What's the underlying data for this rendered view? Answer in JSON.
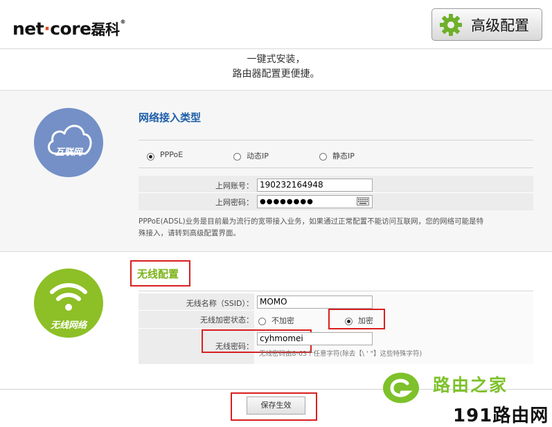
{
  "header": {
    "logo_main": "net",
    "logo_dot": "·",
    "logo_rest": "core",
    "logo_cn": "磊科",
    "logo_reg": "®",
    "advanced_button": "高级配置"
  },
  "slogan": {
    "line1": "一键式安装，",
    "line2": "路由器配置更便捷。"
  },
  "internet": {
    "icon_label": "互联网",
    "title": "网络接入类型",
    "options": [
      {
        "label": "PPPoE",
        "selected": true
      },
      {
        "label": "动态IP",
        "selected": false
      },
      {
        "label": "静态IP",
        "selected": false
      }
    ],
    "account_label": "上网账号：",
    "account_value": "190232164948",
    "password_label": "上网密码：",
    "password_value": "●●●●●●●●",
    "description_line1": "PPPoE(ADSL)业务是目前最为流行的宽带接入业务，如果通过正常配置不能访问互联网，您的网络可能是特",
    "description_line2": "殊接入，请转到高级配置界面。"
  },
  "wireless": {
    "icon_label": "无线网络",
    "title": "无线配置",
    "ssid_label": "无线名称（SSID）：",
    "ssid_value": "MOMO",
    "encrypt_label": "无线加密状态：",
    "encrypt_options": [
      {
        "label": "不加密",
        "selected": false
      },
      {
        "label": "加密",
        "selected": true
      }
    ],
    "password_label": "无线密码：",
    "password_value": "cyhmomei",
    "password_hint": "无线密码由8-63个任意字符(除去【\\ ' \"】这些特殊字符)"
  },
  "save_button": "保存生效",
  "watermark": {
    "line1": "路由之家",
    "line2": "191路由网"
  },
  "colors": {
    "blue_circle": "#7490c6",
    "green_circle": "#8dbf26",
    "title_blue": "#1e5ea8",
    "title_green": "#7ab317",
    "highlight_red": "#d91f1f"
  }
}
